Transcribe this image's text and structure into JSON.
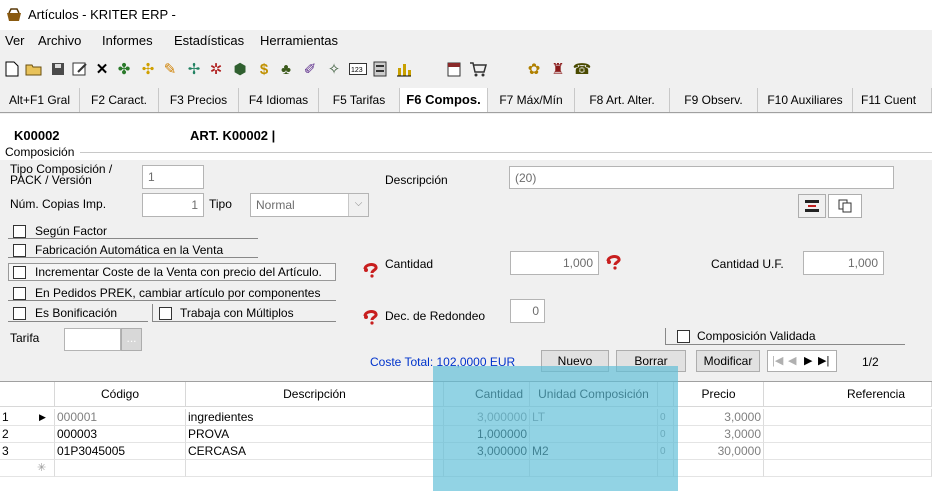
{
  "window": {
    "title": "Artículos - KRITER ERP -"
  },
  "menu": [
    "Ver",
    "Archivo",
    "Informes",
    "Estadísticas",
    "Herramientas"
  ],
  "tabs": [
    "Alt+F1 Gral",
    "F2 Caract.",
    "F3 Precios",
    "F4 Idiomas",
    "F5 Tarifas",
    "F6 Compos.",
    "F7 Máx/Mín",
    "F8 Art. Alter.",
    "F9 Observ.",
    "F10 Auxiliares",
    "F11 Cuent"
  ],
  "header": {
    "code": "K00002",
    "name": "ART. K00002 |",
    "section": "Composición"
  },
  "form": {
    "tipo_comp_label": "Tipo Composición / PACK / Versión",
    "tipo_comp_value": "1",
    "num_copias_label": "Núm. Copias Imp.",
    "num_copias_value": "1",
    "tipo_label": "Tipo",
    "tipo_value": "Normal",
    "descripcion_label": "Descripción",
    "descripcion_value": "(20)",
    "checks": [
      "Según Factor",
      "Fabricación Automática en la Venta",
      "Incrementar Coste de la Venta con precio del Artículo.",
      "En Pedidos PREK, cambiar artículo por componentes",
      "Es Bonificación",
      "Trabaja con Múltiplos"
    ],
    "cantidad_label": "Cantidad",
    "cantidad_value": "1,000",
    "cantidad_uf_label": "Cantidad U.F.",
    "cantidad_uf_value": "1,000",
    "dec_label": "Dec. de Redondeo",
    "dec_value": "0",
    "comp_validada_label": "Composición Validada",
    "tarifa_label": "Tarifa",
    "tarifa_button": "...",
    "coste_total": "Coste Total: 102,0000 EUR",
    "nuevo": "Nuevo",
    "borrar": "Borrar",
    "modificar": "Modificar",
    "page_counter": "1/2"
  },
  "grid": {
    "columns": [
      "Código",
      "Descripción",
      "Cantidad",
      "Unidad Composición",
      "Precio",
      "Referencia"
    ],
    "rows": [
      {
        "num": "1",
        "codigo": "000001",
        "descripcion": "ingredientes",
        "cantidad": "3,000000",
        "unidad": "LT",
        "flag": "0",
        "precio": "3,0000"
      },
      {
        "num": "2",
        "codigo": "000003",
        "descripcion": "PROVA",
        "cantidad": "1,000000",
        "unidad": "",
        "flag": "0",
        "precio": "3,0000"
      },
      {
        "num": "3",
        "codigo": "01P3045005",
        "descripcion": "CERCASA",
        "cantidad": "3,000000",
        "unidad": "M2",
        "flag": "0",
        "precio": "30,0000"
      }
    ]
  },
  "colors": {
    "highlight": "#5ebed7",
    "link_blue": "#0033cc",
    "question_icon": "#c81e1e"
  }
}
